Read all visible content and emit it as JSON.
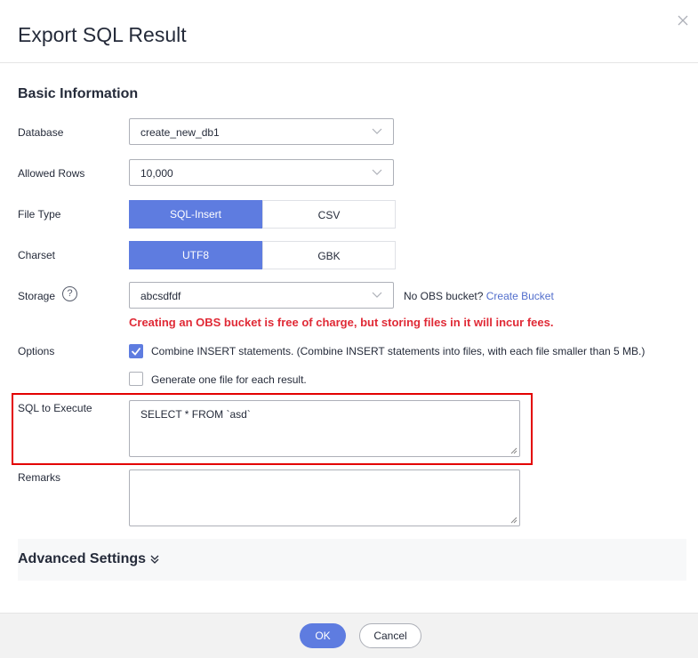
{
  "dialog": {
    "title": "Export SQL Result",
    "close_icon": "close-icon"
  },
  "basic": {
    "section_title": "Basic Information",
    "database": {
      "label": "Database",
      "value": "create_new_db1"
    },
    "allowed_rows": {
      "label": "Allowed Rows",
      "value": "10,000"
    },
    "file_type": {
      "label": "File Type",
      "options": [
        "SQL-Insert",
        "CSV"
      ],
      "selected": "SQL-Insert"
    },
    "charset": {
      "label": "Charset",
      "options": [
        "UTF8",
        "GBK"
      ],
      "selected": "UTF8"
    },
    "storage": {
      "label": "Storage",
      "help_icon": "question-circle-icon",
      "value": "abcsdfdf",
      "no_bucket_text": "No OBS bucket?",
      "create_link": "Create Bucket",
      "warning": "Creating an OBS bucket is free of charge, but storing files in it will incur fees."
    },
    "options": {
      "label": "Options",
      "items": [
        {
          "label": "Combine INSERT statements. (Combine INSERT statements into files, with each file smaller than 5 MB.)",
          "checked": true
        },
        {
          "label": "Generate one file for each result.",
          "checked": false
        }
      ]
    },
    "sql": {
      "label": "SQL to Execute",
      "value": "SELECT * FROM `asd`"
    },
    "remarks": {
      "label": "Remarks",
      "value": ""
    }
  },
  "advanced": {
    "title": "Advanced Settings",
    "icon": "double-chevron-down-icon"
  },
  "footer": {
    "ok": "OK",
    "cancel": "Cancel"
  },
  "colors": {
    "primary": "#5e7ce0",
    "warning": "#e02a36",
    "link": "#526ecc",
    "highlight": "#e30000"
  }
}
